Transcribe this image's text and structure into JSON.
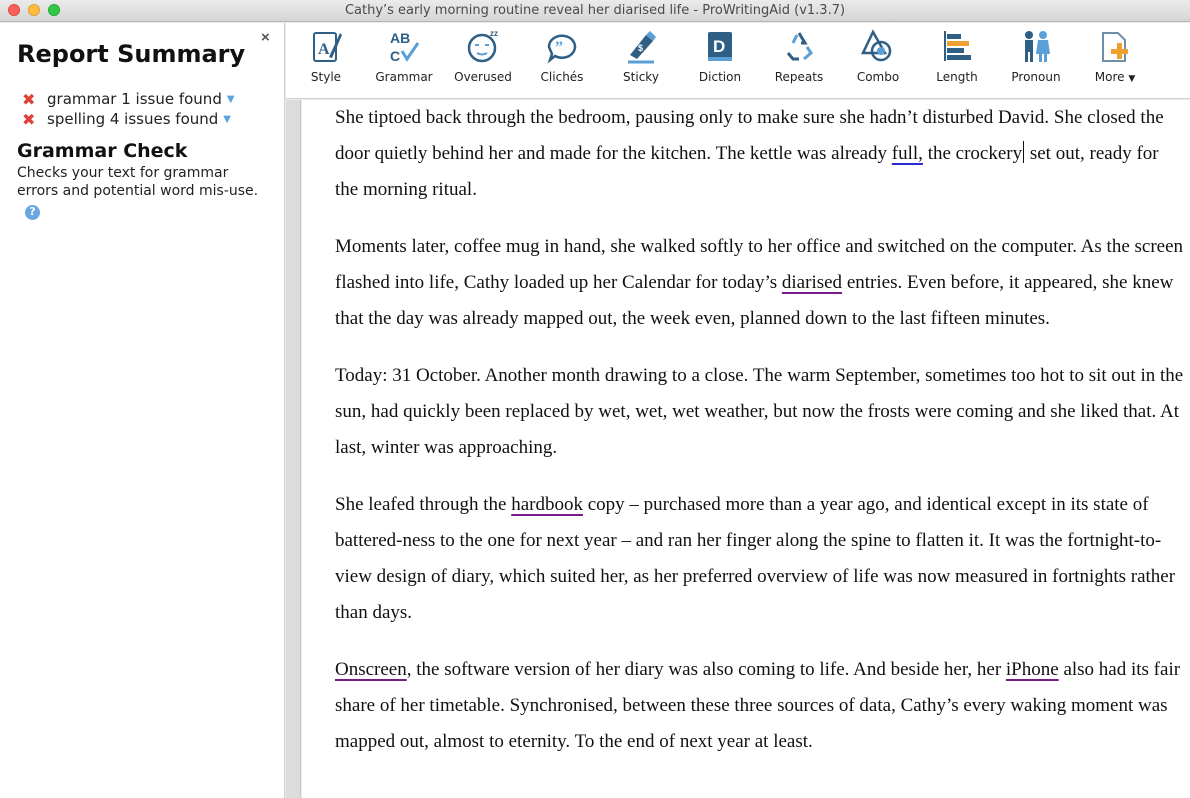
{
  "window": {
    "title": "Cathy’s early morning routine reveal her diarised life - ProWritingAid (v1.3.7)"
  },
  "sidebar": {
    "title": "Report Summary",
    "close_label": "×",
    "issues": [
      {
        "label": "grammar 1 issue found"
      },
      {
        "label": "spelling 4 issues found"
      }
    ],
    "section_title": "Grammar Check",
    "description": "Checks your text for grammar errors and potential word mis-use.",
    "help_label": "?"
  },
  "toolbar": {
    "tools": [
      {
        "label": "Style",
        "icon": "style-icon"
      },
      {
        "label": "Grammar",
        "icon": "grammar-icon"
      },
      {
        "label": "Overused",
        "icon": "overused-icon"
      },
      {
        "label": "Clichés",
        "icon": "cliches-icon"
      },
      {
        "label": "Sticky",
        "icon": "sticky-icon"
      },
      {
        "label": "Diction",
        "icon": "diction-icon"
      },
      {
        "label": "Repeats",
        "icon": "repeats-icon"
      },
      {
        "label": "Combo",
        "icon": "combo-icon"
      },
      {
        "label": "Length",
        "icon": "length-icon"
      },
      {
        "label": "Pronoun",
        "icon": "pronoun-icon"
      },
      {
        "label": "More",
        "icon": "more-icon"
      }
    ]
  },
  "document": {
    "p1": {
      "a": "She tiptoed back through the bedroom, pausing only to make sure she hadn’t disturbed David. She closed the door quietly behind her and made for the kitchen. The kettle was already ",
      "flag": "full,",
      "b": " the crockery",
      "c": " set out, ready for the morning ritual."
    },
    "p2": {
      "a": "Moments later, coffee mug in hand, she walked softly to her office and switched on the computer. As the screen flashed into life, Cathy loaded up her Calendar for today’s ",
      "flag": "diarised",
      "b": " entries. Even before, it appeared, she knew that the day was already mapped out, the week even, planned down to the last fifteen minutes."
    },
    "p3": "Today: 31 October. Another month drawing to a close. The warm September, sometimes too hot to sit out in the sun, had quickly been replaced by wet, wet, wet weather, but now the frosts were coming and she liked that. At last, winter was approaching.",
    "p4": {
      "a": "She leafed through the ",
      "flag": "hardbook",
      "b": " copy – purchased more than a year ago, and identical except in its state of battered-ness to the one for next year – and ran her finger along the spine to flatten it. It was the fortnight-to-view design of diary, which suited her, as her preferred overview of life was now measured in fortnights rather than days."
    },
    "p5": {
      "flag1": "Onscreen",
      "a": ", the software version of her diary was also coming to life. And beside her, her ",
      "flag2": "iPhone",
      "b": " also had its fair share of her timetable. Synchronised, between these three sources of data, Cathy’s every waking moment was mapped out, almost to eternity. To the end of next year at least."
    }
  },
  "colors": {
    "grammar_underline": "#2a2ad0",
    "spelling_underline": "#7a1a8a",
    "issue_icon": "#e0403a",
    "help_icon": "#6aa6e0"
  }
}
